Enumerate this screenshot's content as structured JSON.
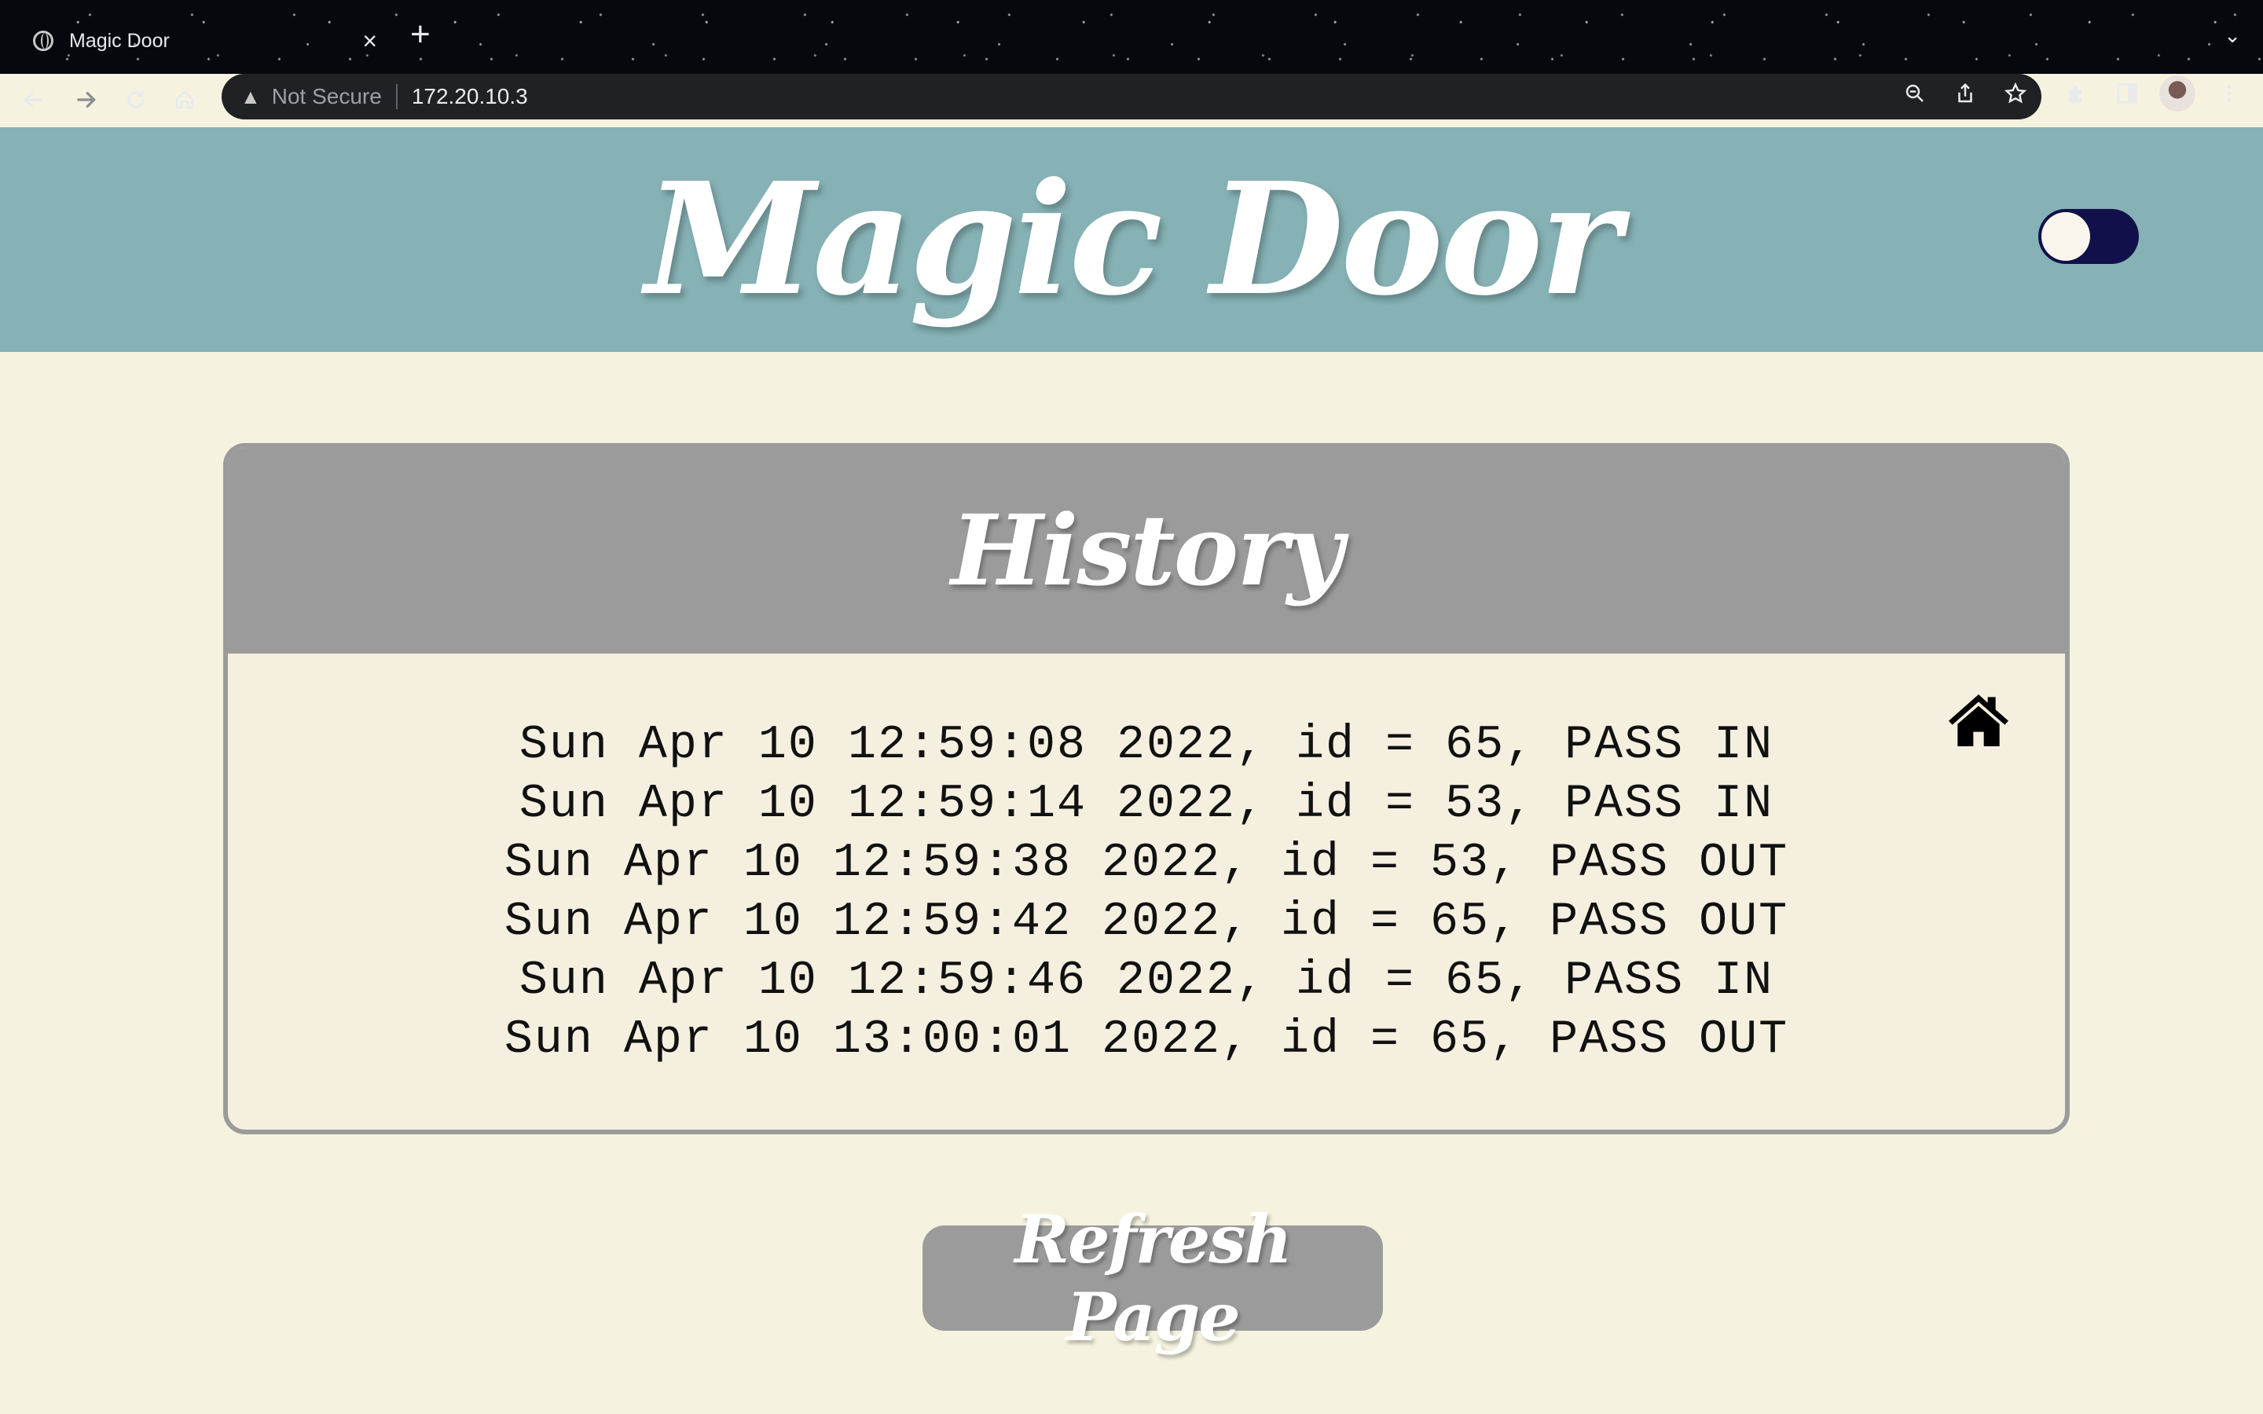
{
  "browser": {
    "tab_title": "Magic Door",
    "tab_close": "×",
    "new_tab": "+",
    "tab_menu": "⌄",
    "security_label": "Not Secure",
    "url": "172.20.10.3",
    "icons": [
      "back-icon",
      "forward-icon",
      "reload-icon",
      "home-icon",
      "zoom-out-icon",
      "share-icon",
      "star-icon",
      "extensions-icon",
      "sidepanel-icon",
      "profile-avatar",
      "menu-icon"
    ]
  },
  "header": {
    "title": "Magic Door",
    "background": "#86b2b5",
    "toggle_color": "#12104a"
  },
  "history": {
    "title": "History",
    "entries": [
      "Sun Apr 10 12:59:08 2022, id = 65, PASS IN",
      "Sun Apr 10 12:59:14 2022, id = 53, PASS IN",
      "Sun Apr 10 12:59:38 2022, id = 53, PASS OUT",
      "Sun Apr 10 12:59:42 2022, id = 65, PASS OUT",
      "Sun Apr 10 12:59:46 2022, id = 65, PASS IN",
      "Sun Apr 10 13:00:01 2022, id = 65, PASS OUT"
    ]
  },
  "actions": {
    "refresh_label": "Refresh Page"
  }
}
